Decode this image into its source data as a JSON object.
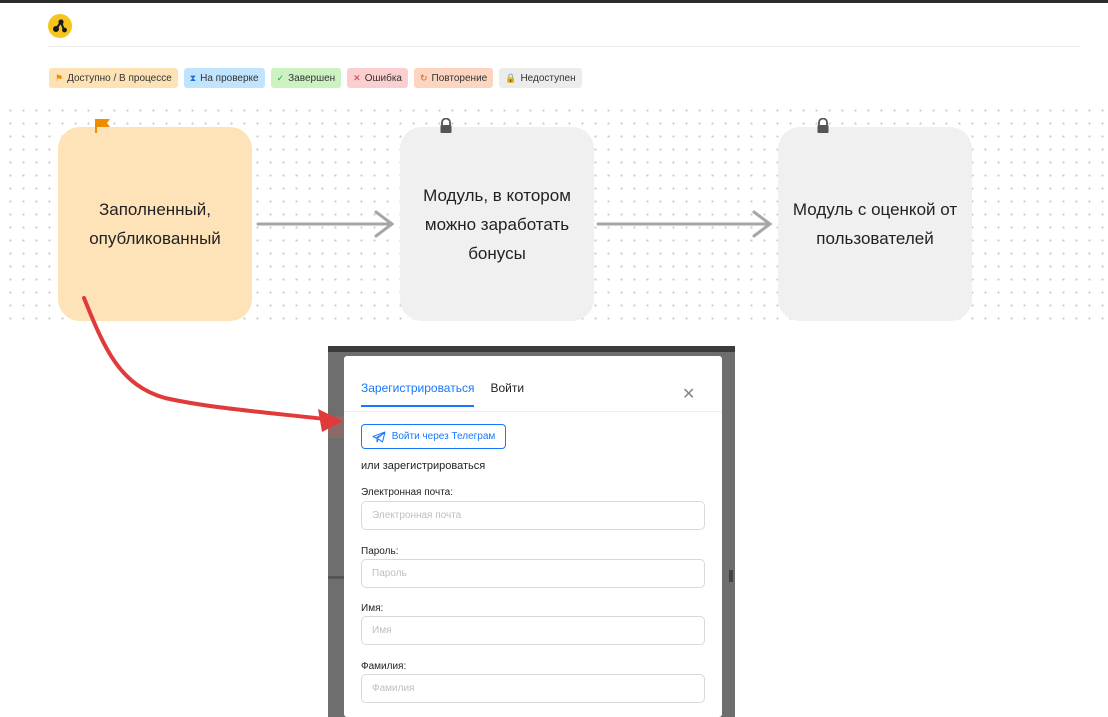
{
  "legend": [
    {
      "label": "Доступно / В процессе",
      "icon": "flag-icon",
      "glyph": "⚑",
      "bg": "#fde2b5",
      "icon_color": "#f08c00"
    },
    {
      "label": "На проверке",
      "icon": "hourglass-icon",
      "glyph": "⧗",
      "bg": "#bfe4fb",
      "icon_color": "#1c6fd8"
    },
    {
      "label": "Завершен",
      "icon": "check-icon",
      "glyph": "✓",
      "bg": "#cdf2c2",
      "icon_color": "#2f9e44"
    },
    {
      "label": "Ошибка",
      "icon": "cross-icon",
      "glyph": "✕",
      "bg": "#fbcfcf",
      "icon_color": "#e03131"
    },
    {
      "label": "Повторение",
      "icon": "repeat-icon",
      "glyph": "↻",
      "bg": "#fcd5c0",
      "icon_color": "#e8590c"
    },
    {
      "label": "Недоступен",
      "icon": "lock-icon",
      "glyph": "🔒",
      "bg": "#ececec",
      "icon_color": "#666666"
    }
  ],
  "nodes": [
    {
      "label": "Заполненный, опубликованный",
      "status": "available",
      "icon": "flag-icon",
      "bg": "#ffe3b8"
    },
    {
      "label": "Модуль, в котором можно заработать бонусы",
      "status": "locked",
      "icon": "lock-icon",
      "bg": "#f0f0f0"
    },
    {
      "label": "Модуль с оценкой от пользователей",
      "status": "locked",
      "icon": "lock-icon",
      "bg": "#f0f0f0"
    }
  ],
  "modal": {
    "tab_register": "Зарегистрироваться",
    "tab_login": "Войти",
    "close_glyph": "✕",
    "telegram_button": "Войти через Телеграм",
    "or_text": "или зарегистрироваться",
    "fields": [
      {
        "label": "Электронная почта:",
        "placeholder": "Электронная почта"
      },
      {
        "label": "Пароль:",
        "placeholder": "Пароль"
      },
      {
        "label": "Имя:",
        "placeholder": "Имя"
      },
      {
        "label": "Фамилия:",
        "placeholder": "Фамилия"
      }
    ]
  },
  "colors": {
    "accent": "#1677ff",
    "annotation_arrow": "#e03a3a",
    "flow_arrow": "#a6a6a6",
    "logo": "#f5c51e"
  }
}
